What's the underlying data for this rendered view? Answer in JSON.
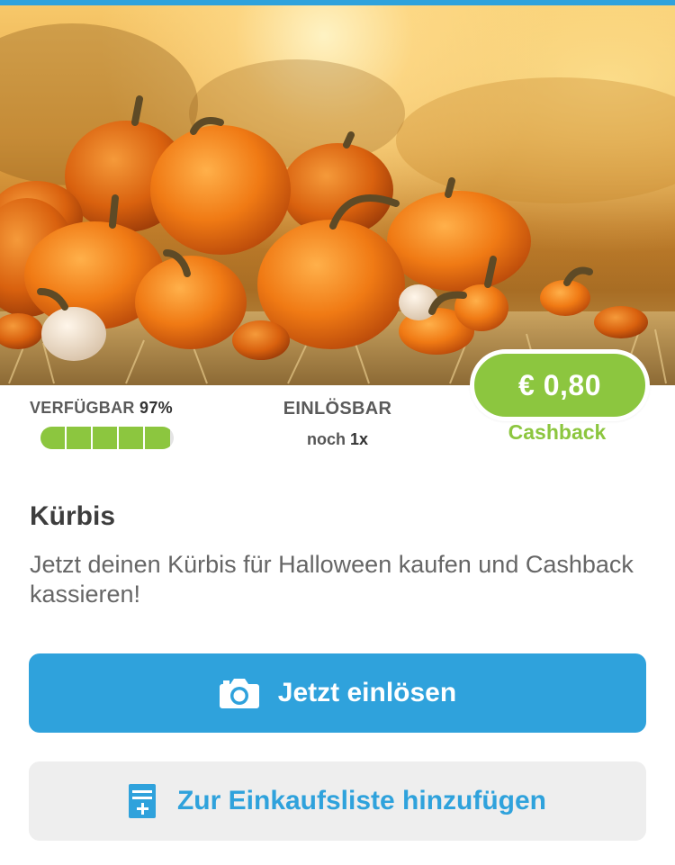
{
  "colors": {
    "accent_blue": "#2fa2dc",
    "accent_green": "#8cc63f",
    "secondary_bg": "#eeeeee"
  },
  "hero": {
    "image": "pumpkins-photo"
  },
  "cashback": {
    "amount": "€ 0,80",
    "label": "Cashback"
  },
  "availability": {
    "label": "VERFÜGBAR",
    "percent_text": "97%",
    "fill_fraction": 0.97
  },
  "redeemable": {
    "label": "EINLÖSBAR",
    "prefix": "noch",
    "count": "1x"
  },
  "offer": {
    "title": "Kürbis",
    "description": "Jetzt deinen Kürbis für Halloween kaufen und Cashback kassieren!"
  },
  "actions": {
    "redeem": {
      "label": "Jetzt einlösen",
      "icon": "camera-icon"
    },
    "add_to_list": {
      "label": "Zur Einkaufsliste hinzufügen",
      "icon": "shopping-list-add-icon"
    }
  }
}
